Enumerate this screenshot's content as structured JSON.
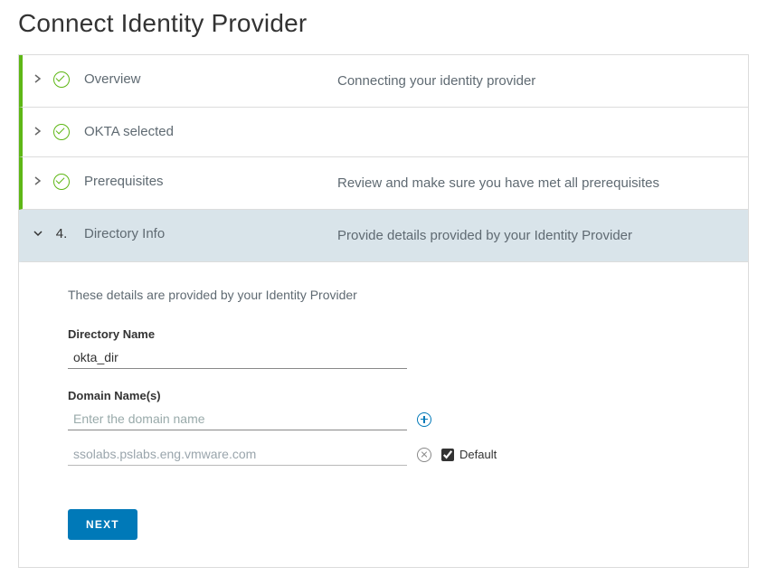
{
  "page": {
    "title": "Connect Identity Provider"
  },
  "steps": [
    {
      "title": "Overview",
      "desc": "Connecting your identity provider"
    },
    {
      "title": "OKTA selected",
      "desc": ""
    },
    {
      "title": "Prerequisites",
      "desc": "Review and make sure you have met all prerequisites"
    }
  ],
  "activeStep": {
    "number": "4.",
    "title": "Directory Info",
    "desc": "Provide details provided by your Identity Provider"
  },
  "directoryInfo": {
    "intro": "These details are provided by your Identity Provider",
    "directoryNameLabel": "Directory Name",
    "directoryName": "okta_dir",
    "domainNamesLabel": "Domain Name(s)",
    "domainPlaceholder": "Enter the domain name",
    "domains": [
      {
        "value": "ssolabs.pslabs.eng.vmware.com",
        "default": true
      }
    ],
    "defaultLabel": "Default",
    "nextButton": "NEXT"
  }
}
